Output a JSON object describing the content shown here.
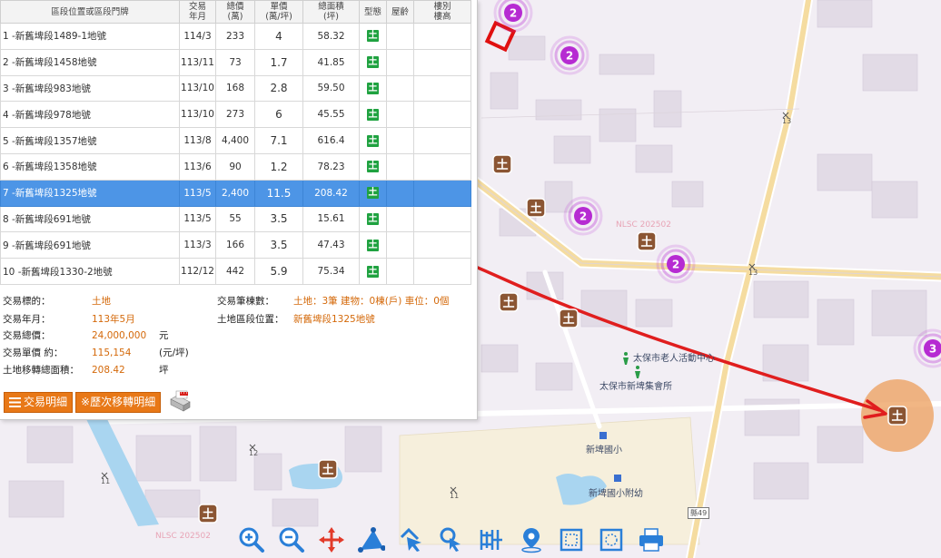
{
  "table": {
    "headers": {
      "address": "區段位置或區段門牌",
      "date_l1": "交易",
      "date_l2": "年月",
      "total_l1": "總價",
      "total_l2": "(萬)",
      "unit_l1": "單價",
      "unit_l2": "(萬/坪)",
      "area_l1": "總面積",
      "area_l2": "(坪)",
      "type": "型態",
      "age": "屋齡",
      "floor_l1": "樓別",
      "floor_l2": "樓高"
    },
    "rows": [
      {
        "address": "1 -新舊埤段1489-1地號",
        "date": "114/3",
        "total": "233",
        "unit": "4",
        "area": "58.32",
        "type_icon": "土"
      },
      {
        "address": "2 -新舊埤段1458地號",
        "date": "113/11",
        "total": "73",
        "unit": "1.7",
        "area": "41.85",
        "type_icon": "土"
      },
      {
        "address": "3 -新舊埤段983地號",
        "date": "113/10",
        "total": "168",
        "unit": "2.8",
        "area": "59.50",
        "type_icon": "土"
      },
      {
        "address": "4 -新舊埤段978地號",
        "date": "113/10",
        "total": "273",
        "unit": "6",
        "area": "45.55",
        "type_icon": "土"
      },
      {
        "address": "5 -新舊埤段1357地號",
        "date": "113/8",
        "total": "4,400",
        "unit": "7.1",
        "area": "616.4",
        "type_icon": "土"
      },
      {
        "address": "6 -新舊埤段1358地號",
        "date": "113/6",
        "total": "90",
        "unit": "1.2",
        "area": "78.23",
        "type_icon": "土"
      },
      {
        "address": "7 -新舊埤段1325地號",
        "date": "113/5",
        "total": "2,400",
        "unit": "11.5",
        "area": "208.42",
        "type_icon": "土"
      },
      {
        "address": "8 -新舊埤段691地號",
        "date": "113/5",
        "total": "55",
        "unit": "3.5",
        "area": "15.61",
        "type_icon": "土"
      },
      {
        "address": "9 -新舊埤段691地號",
        "date": "113/3",
        "total": "166",
        "unit": "3.5",
        "area": "47.43",
        "type_icon": "土"
      },
      {
        "address": "10 -新舊埤段1330-2地號",
        "date": "112/12",
        "total": "442",
        "unit": "5.9",
        "area": "75.34",
        "type_icon": "土"
      }
    ]
  },
  "detail": {
    "target_label": "交易標的：",
    "target_value": "土地",
    "ym_label": "交易年月：",
    "ym_value": "113年5月",
    "total_label": "交易總價：",
    "total_value": "24,000,000",
    "total_unit": "元",
    "unit_label": "交易單價 約：",
    "unit_value": "115,154",
    "unit_unit": "(元/坪)",
    "area_label": "土地移轉總面積：",
    "area_value": "208.42",
    "area_unit": "坪",
    "count_label": "交易筆棟數：",
    "count_value": "土地：3筆 建物：0棟(戶) 車位：0個",
    "location_label": "土地區段位置：",
    "location_value": "新舊埤段1325地號"
  },
  "buttons": {
    "tx_detail": "交易明細",
    "history": "※歷次移轉明細",
    "pdf_icon": "pdf-icon"
  },
  "map": {
    "cluster_labels": [
      "2",
      "2",
      "2",
      "2",
      "3"
    ],
    "land_marker": "土",
    "labels": {
      "elderly_center": "太保市老人活動中心",
      "assembly_hall": "太保市新埤集會所",
      "school": "新埤國小",
      "kindergarten": "新埤國小附幼",
      "nlsc1": "NLSC 202502",
      "nlsc2": "NLSC 202502",
      "road_num_1": "13",
      "road_num_2": "13",
      "road_num_3": "12",
      "road_num_4": "11",
      "road_num_5": "11",
      "road_sign": "縣49"
    }
  },
  "toolbar": {
    "tools": [
      "zoom-in-icon",
      "zoom-out-icon",
      "pan-icon",
      "measure-area-icon",
      "select-icon",
      "identify-icon",
      "measure-distance-icon",
      "location-icon",
      "full-extent-icon",
      "clear-icon",
      "print-icon"
    ]
  },
  "colors": {
    "selected_row": "#4d95e6",
    "accent_orange": "#e87817",
    "land_green": "#1fa240",
    "cluster_purple": "#b62bd2",
    "annotation_red": "#e01e1e",
    "highlight_circle": "#ec9d5b"
  }
}
